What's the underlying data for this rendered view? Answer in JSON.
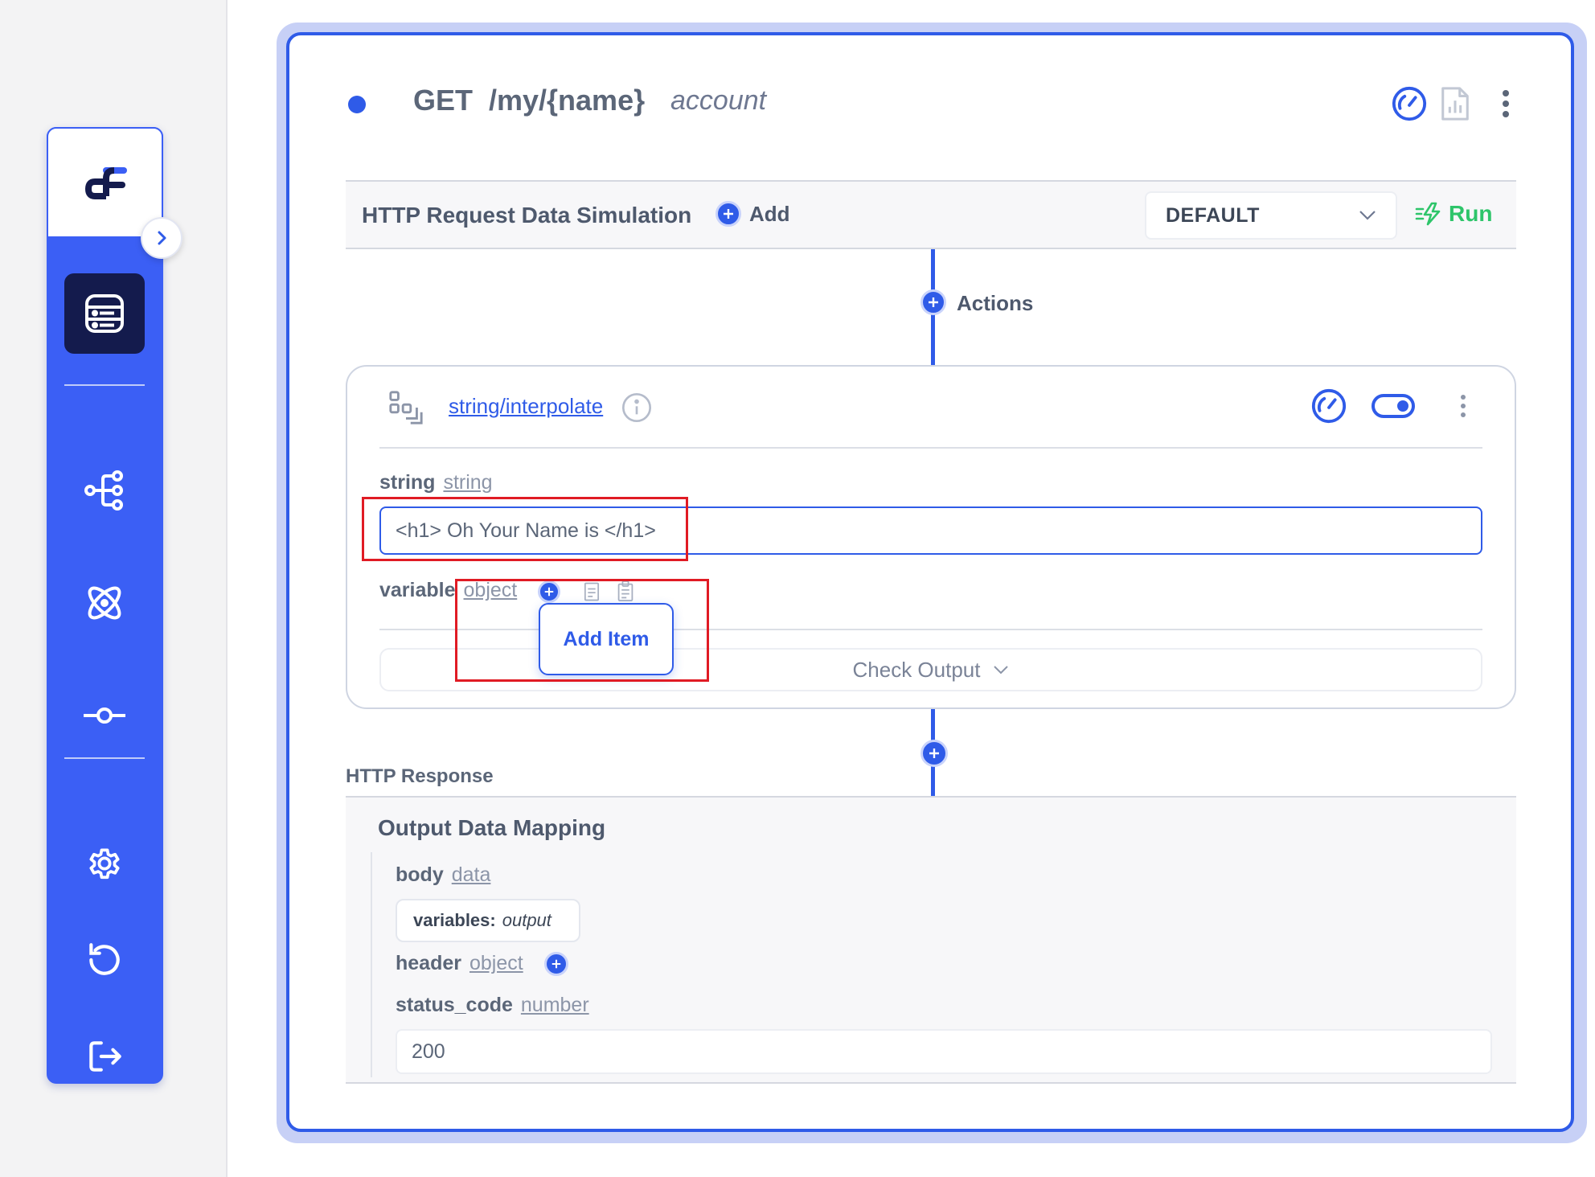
{
  "sidebar": {
    "logo": "dreamflow-logo",
    "collapse_icon": "chevron-right-icon",
    "items": [
      {
        "name": "api-endpoints",
        "icon": "server-stack-icon",
        "active": true
      },
      {
        "name": "workflows",
        "icon": "workflow-tree-icon"
      },
      {
        "name": "integrations",
        "icon": "atom-icon"
      },
      {
        "name": "commits",
        "icon": "commit-icon"
      },
      {
        "name": "settings",
        "icon": "gear-icon"
      },
      {
        "name": "history",
        "icon": "undo-history-icon"
      },
      {
        "name": "logout",
        "icon": "logout-icon"
      }
    ]
  },
  "endpoint": {
    "method": "GET",
    "path": "/my/{name}",
    "name": "account",
    "status_color": "#2f5be8"
  },
  "simulation": {
    "title": "HTTP Request Data Simulation",
    "add_label": "Add",
    "environment": "DEFAULT",
    "run_label": "Run"
  },
  "actions": {
    "label": "Actions",
    "card": {
      "function": "string/interpolate",
      "fields": {
        "string_label": "string",
        "string_type": "string",
        "string_value": "<h1> Oh Your Name is  </h1>",
        "variable_label": "variable",
        "variable_type": "object"
      },
      "add_item_label": "Add Item",
      "check_output_label": "Check Output"
    }
  },
  "response": {
    "label": "HTTP Response",
    "mapping_title": "Output Data Mapping",
    "body_label": "body",
    "body_type": "data",
    "variables_key": "variables:",
    "variables_value": "output",
    "header_label": "header",
    "header_type": "object",
    "status_code_label": "status_code",
    "status_code_type": "number",
    "status_code_value": "200"
  },
  "colors": {
    "accent": "#2f5be8",
    "sidebar": "#3b5ff5",
    "run": "#2ec56a",
    "highlight": "#e01b24"
  }
}
